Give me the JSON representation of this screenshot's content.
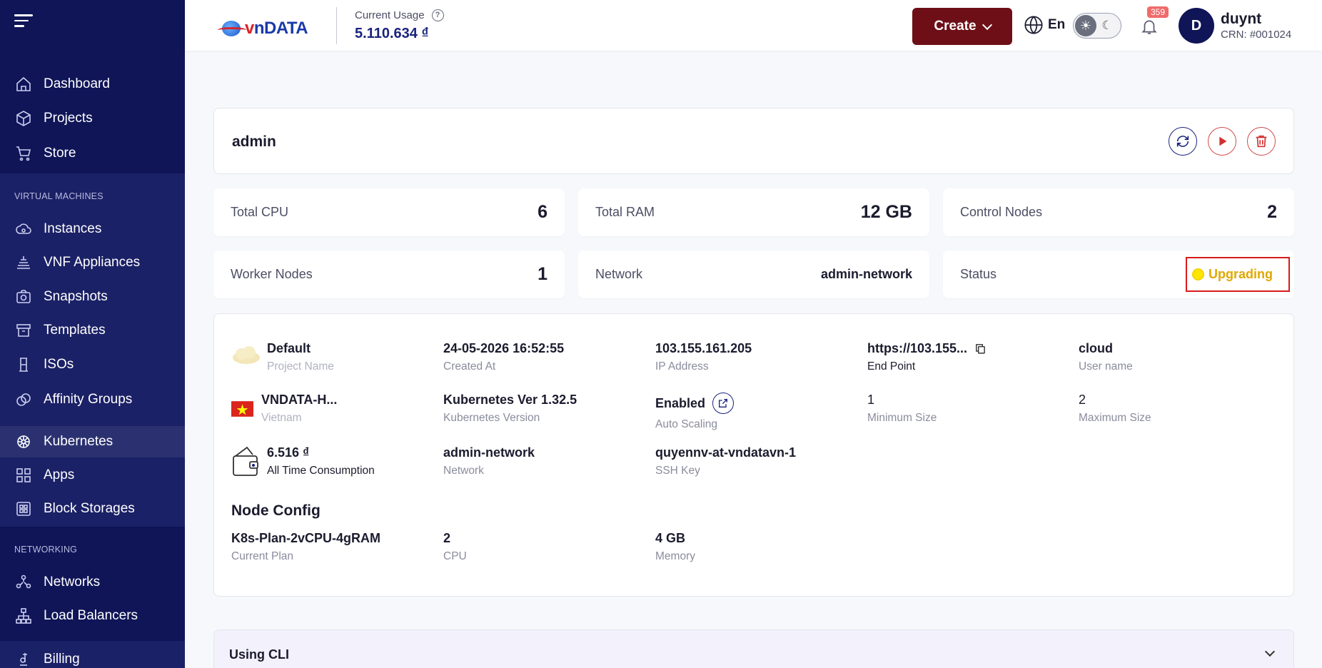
{
  "sidebar": {
    "items": [
      {
        "label": "Dashboard"
      },
      {
        "label": "Projects"
      },
      {
        "label": "Store"
      },
      {
        "label": "Instances"
      },
      {
        "label": "VNF Appliances"
      },
      {
        "label": "Snapshots"
      },
      {
        "label": "Templates"
      },
      {
        "label": "ISOs"
      },
      {
        "label": "Affinity Groups"
      },
      {
        "label": "Kubernetes"
      },
      {
        "label": "Apps"
      },
      {
        "label": "Block Storages"
      },
      {
        "label": "Networks"
      },
      {
        "label": "Load Balancers"
      },
      {
        "label": "Billing"
      }
    ],
    "sections": {
      "virtual_machines": "VIRTUAL MACHINES",
      "networking": "NETWORKING"
    }
  },
  "header": {
    "logo_v": "v",
    "logo_text": "nDATA",
    "usage_label": "Current Usage",
    "usage_value": "5.110.634 ₫",
    "create_label": "Create",
    "language": "En",
    "notifications_count": "359",
    "avatar_initial": "D",
    "user_name": "duynt",
    "user_crn": "CRN: #001024"
  },
  "cluster": {
    "title": "admin",
    "stats": {
      "total_cpu_label": "Total CPU",
      "total_cpu": "6",
      "total_ram_label": "Total RAM",
      "total_ram": "12 GB",
      "control_nodes_label": "Control Nodes",
      "control_nodes": "2",
      "worker_nodes_label": "Worker Nodes",
      "worker_nodes": "1",
      "network_label": "Network",
      "network": "admin-network",
      "status_label": "Status",
      "status": "Upgrading"
    },
    "details": {
      "project_name": "Default",
      "project_name_label": "Project Name",
      "created_at": "24-05-2026 16:52:55",
      "created_at_label": "Created At",
      "ip_address": "103.155.161.205",
      "ip_address_label": "IP Address",
      "end_point": "https://103.155...",
      "end_point_label": "End Point",
      "user_name": "cloud",
      "user_name_label": "User name",
      "zone": "VNDATA-H...",
      "zone_label": "Vietnam",
      "k8s_version": "Kubernetes Ver 1.32.5",
      "k8s_version_label": "Kubernetes Version",
      "auto_scaling": "Enabled",
      "auto_scaling_label": "Auto Scaling",
      "min_size": "1",
      "min_size_label": "Minimum Size",
      "max_size": "2",
      "max_size_label": "Maximum Size",
      "consumption": "6.516 ₫",
      "consumption_label": "All Time Consumption",
      "network": "admin-network",
      "network_label": "Network",
      "ssh_key": "quyennv-at-vndatavn-1",
      "ssh_key_label": "SSH Key"
    },
    "node_config": {
      "title": "Node Config",
      "plan": "K8s-Plan-2vCPU-4gRAM",
      "plan_label": "Current Plan",
      "cpu": "2",
      "cpu_label": "CPU",
      "memory": "4 GB",
      "memory_label": "Memory"
    },
    "cli_title": "Using CLI"
  },
  "colors": {
    "sidebar_bg": "#0f1557",
    "create_btn": "#6e0f17",
    "status": "#e0a800",
    "highlight": "#d81b1b"
  }
}
